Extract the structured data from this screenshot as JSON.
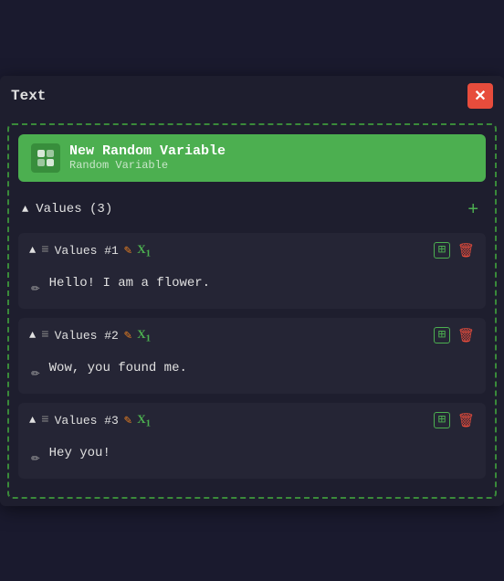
{
  "window": {
    "title": "Text",
    "close_label": "✕"
  },
  "variable": {
    "icon": "🎲",
    "name": "New Random Variable",
    "type": "Random Variable"
  },
  "values_section": {
    "label": "Values (3)",
    "add_label": "+"
  },
  "values": [
    {
      "id": 1,
      "label": "Values #1",
      "text": "Hello! I am a flower."
    },
    {
      "id": 2,
      "label": "Values #2",
      "text": "Wow, you found me."
    },
    {
      "id": 3,
      "label": "Values #3",
      "text": "Hey you!"
    }
  ],
  "icons": {
    "chevron_down": "▲",
    "drag": "≡",
    "edit": "🖊",
    "variable": "X₁",
    "pencil": "✏",
    "add": "⊞",
    "delete": "🗑"
  }
}
